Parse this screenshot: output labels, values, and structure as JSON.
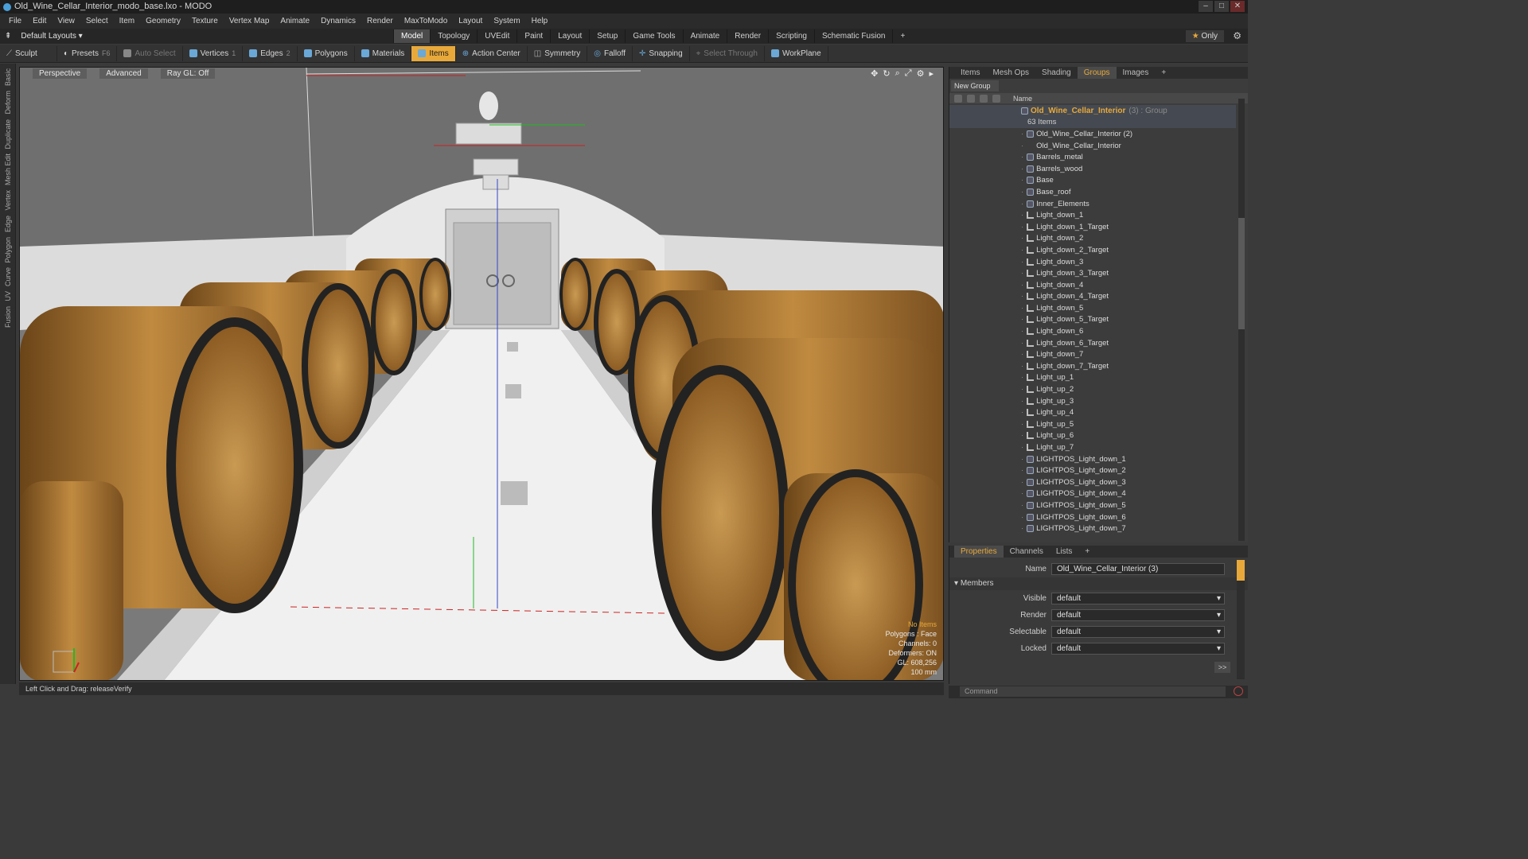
{
  "window": {
    "title": "Old_Wine_Cellar_Interior_modo_base.lxo - MODO"
  },
  "menu": [
    "File",
    "Edit",
    "View",
    "Select",
    "Item",
    "Geometry",
    "Texture",
    "Vertex Map",
    "Animate",
    "Dynamics",
    "Render",
    "MaxToModo",
    "Layout",
    "System",
    "Help"
  ],
  "layout": {
    "default_layouts": "Default Layouts",
    "tabs": [
      "Model",
      "Topology",
      "UVEdit",
      "Paint",
      "Layout",
      "Setup",
      "Game Tools",
      "Animate",
      "Render",
      "Scripting",
      "Schematic Fusion"
    ],
    "active_tab": "Model",
    "only_label": "Only",
    "add_tab": "+"
  },
  "toolbar": {
    "sculpt": "Sculpt",
    "presets": "Presets",
    "presets_key": "F6",
    "auto_select": "Auto Select",
    "vertices": "Vertices",
    "vertices_key": "1",
    "edges": "Edges",
    "edges_key": "2",
    "polygons": "Polygons",
    "materials": "Materials",
    "items": "Items",
    "action_center": "Action Center",
    "symmetry": "Symmetry",
    "falloff": "Falloff",
    "snapping": "Snapping",
    "select_through": "Select Through",
    "workplane": "WorkPlane"
  },
  "left_strip": [
    "Basic",
    "Deform",
    "Duplicate",
    "Mesh Edit",
    "Vertex",
    "Edge",
    "Polygon",
    "Curve",
    "UV",
    "Fusion"
  ],
  "viewport": {
    "view": "Perspective",
    "shading": "Advanced",
    "raygl": "Ray GL: Off",
    "info": {
      "no_items": "No Items",
      "polygons": "Polygons : Face",
      "channels": "Channels: 0",
      "deformers": "Deformers: ON",
      "gl": "GL: 608,256",
      "scale": "100 mm"
    }
  },
  "status": {
    "text": "Left Click and Drag:  releaseVerify"
  },
  "right_panel": {
    "tabs": [
      "Items",
      "Mesh Ops",
      "Shading",
      "Groups",
      "Images"
    ],
    "active_tab": "Groups",
    "new_group": "New Group",
    "name_header": "Name",
    "group_name": "Old_Wine_Cellar_Interior",
    "group_suffix": "(3) : Group",
    "count": "63 Items",
    "items": [
      {
        "label": "Old_Wine_Cellar_Interior (2)",
        "kind": "mesh"
      },
      {
        "label": "Old_Wine_Cellar_Interior",
        "kind": "none"
      },
      {
        "label": "Barrels_metal",
        "kind": "mesh"
      },
      {
        "label": "Barrels_wood",
        "kind": "mesh"
      },
      {
        "label": "Base",
        "kind": "mesh"
      },
      {
        "label": "Base_roof",
        "kind": "mesh"
      },
      {
        "label": "Inner_Elements",
        "kind": "mesh"
      },
      {
        "label": "Light_down_1",
        "kind": "light"
      },
      {
        "label": "Light_down_1_Target",
        "kind": "light"
      },
      {
        "label": "Light_down_2",
        "kind": "light"
      },
      {
        "label": "Light_down_2_Target",
        "kind": "light"
      },
      {
        "label": "Light_down_3",
        "kind": "light"
      },
      {
        "label": "Light_down_3_Target",
        "kind": "light"
      },
      {
        "label": "Light_down_4",
        "kind": "light"
      },
      {
        "label": "Light_down_4_Target",
        "kind": "light"
      },
      {
        "label": "Light_down_5",
        "kind": "light"
      },
      {
        "label": "Light_down_5_Target",
        "kind": "light"
      },
      {
        "label": "Light_down_6",
        "kind": "light"
      },
      {
        "label": "Light_down_6_Target",
        "kind": "light"
      },
      {
        "label": "Light_down_7",
        "kind": "light"
      },
      {
        "label": "Light_down_7_Target",
        "kind": "light"
      },
      {
        "label": "Light_up_1",
        "kind": "light"
      },
      {
        "label": "Light_up_2",
        "kind": "light"
      },
      {
        "label": "Light_up_3",
        "kind": "light"
      },
      {
        "label": "Light_up_4",
        "kind": "light"
      },
      {
        "label": "Light_up_5",
        "kind": "light"
      },
      {
        "label": "Light_up_6",
        "kind": "light"
      },
      {
        "label": "Light_up_7",
        "kind": "light"
      },
      {
        "label": "LIGHTPOS_Light_down_1",
        "kind": "mesh"
      },
      {
        "label": "LIGHTPOS_Light_down_2",
        "kind": "mesh"
      },
      {
        "label": "LIGHTPOS_Light_down_3",
        "kind": "mesh"
      },
      {
        "label": "LIGHTPOS_Light_down_4",
        "kind": "mesh"
      },
      {
        "label": "LIGHTPOS_Light_down_5",
        "kind": "mesh"
      },
      {
        "label": "LIGHTPOS_Light_down_6",
        "kind": "mesh"
      },
      {
        "label": "LIGHTPOS_Light_down_7",
        "kind": "mesh"
      }
    ]
  },
  "properties": {
    "tabs": [
      "Properties",
      "Channels",
      "Lists"
    ],
    "active_tab": "Properties",
    "name_label": "Name",
    "name_value": "Old_Wine_Cellar_Interior (3)",
    "members": "Members",
    "fields": [
      {
        "label": "Visible",
        "value": "default"
      },
      {
        "label": "Render",
        "value": "default"
      },
      {
        "label": "Selectable",
        "value": "default"
      },
      {
        "label": "Locked",
        "value": "default"
      }
    ],
    "more": ">>"
  },
  "command": {
    "placeholder": "Command"
  },
  "colors": {
    "accent": "#e8a93a",
    "panel": "#3c3c3c",
    "selected_row": "#454a52"
  }
}
